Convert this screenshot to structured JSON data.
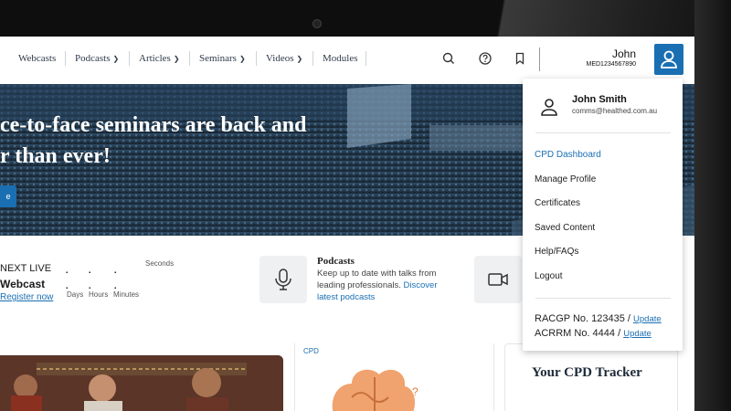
{
  "nav": {
    "links": [
      "Webcasts",
      "Podcasts",
      "Articles",
      "Seminars",
      "Videos",
      "Modules"
    ],
    "user_name": "John",
    "user_id": "MED1234567890"
  },
  "hero": {
    "title_line1": "ce-to-face seminars are back and",
    "title_line2": "r than ever!",
    "button_label": "e"
  },
  "events": {
    "live_label": "NEXT LIVE",
    "type_label": "Webcast",
    "register_link": "Register now",
    "countdown_labels": [
      "Days",
      "Hours",
      "Minutes",
      "Seconds"
    ]
  },
  "podcasts": {
    "title": "Podcasts",
    "text": "Keep up to date with talks from leading professionals.",
    "link": "Discover latest podcasts"
  },
  "cards": {
    "cpd_tag": "CPD",
    "tracker_title": "Your CPD Tracker"
  },
  "dropdown": {
    "name": "John Smith",
    "email": "comms@healthed.com.au",
    "items": [
      "CPD Dashboard",
      "Manage Profile",
      "Certificates",
      "Saved Content",
      "Help/FAQs",
      "Logout"
    ],
    "racgp_text": "RACGP No. 123435 / ",
    "acrrm_text": "ACRRM No. 4444 / ",
    "update_label": "Update"
  },
  "colors": {
    "accent": "#1a6fb3"
  }
}
